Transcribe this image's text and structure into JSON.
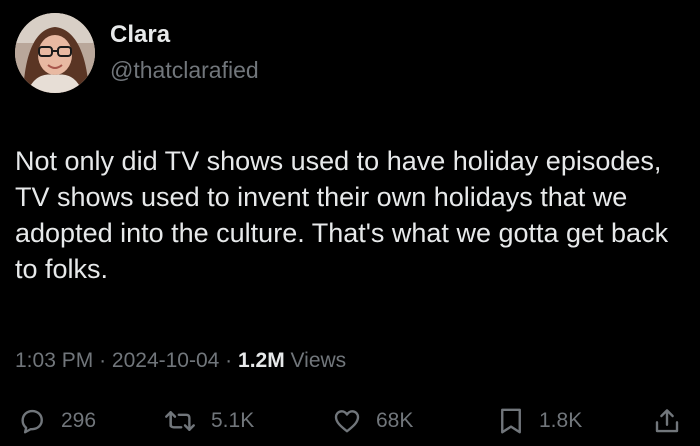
{
  "author": {
    "name": "Clara",
    "handle": "@thatclarafied",
    "avatar_icon": "profile-photo"
  },
  "tweet": {
    "text": "Not only did TV shows used to have holiday episodes, TV shows used to invent their own holidays that we adopted into the culture. That's what we gotta get back to folks."
  },
  "meta": {
    "time": "1:03 PM",
    "separator": "·",
    "date": "2024-10-04",
    "views_count": "1.2M",
    "views_label": "Views"
  },
  "actions": {
    "replies": "296",
    "retweets": "5.1K",
    "likes": "68K",
    "bookmarks": "1.8K"
  },
  "colors": {
    "background": "#000000",
    "primary_text": "#e7e9ea",
    "secondary_text": "#71767b"
  }
}
